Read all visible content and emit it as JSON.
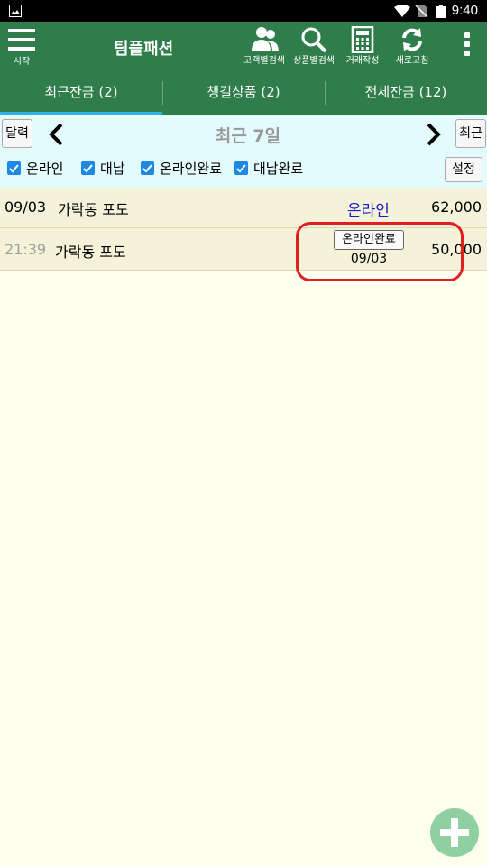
{
  "status_bar": {
    "time": "9:40"
  },
  "app_bar": {
    "menu_label": "시작",
    "title": "팀플패션",
    "tools": [
      {
        "icon": "people-icon",
        "label": "고객별검색"
      },
      {
        "icon": "search-icon",
        "label": "상품별검색"
      },
      {
        "icon": "calculator-icon",
        "label": "거래작성"
      },
      {
        "icon": "refresh-icon",
        "label": "새로고침"
      }
    ]
  },
  "tabs": [
    {
      "label": "최근잔금 (2)",
      "active": true
    },
    {
      "label": "챙길상품 (2)",
      "active": false
    },
    {
      "label": "전체잔금 (12)",
      "active": false
    }
  ],
  "filter": {
    "calendar_button": "달력",
    "period": "최근 7일",
    "recent_button": "최근",
    "settings_button": "설정",
    "checkboxes": [
      {
        "label": "온라인",
        "checked": true
      },
      {
        "label": "대납",
        "checked": true
      },
      {
        "label": "온라인완료",
        "checked": true
      },
      {
        "label": "대납완료",
        "checked": true
      }
    ]
  },
  "rows": [
    {
      "date": "09/03",
      "customer": "가락동 포도",
      "status": "온라인",
      "amount": "62,000"
    },
    {
      "time": "21:39",
      "customer": "가락동 포도",
      "status_badge": "온라인완료",
      "status_date": "09/03",
      "amount": "50,000"
    }
  ],
  "colors": {
    "app_bar": "#2e7d4a",
    "tab_indicator": "#2fb3e6",
    "filter_bg": "#e4fbfd",
    "row_bg": "#f4f2d8",
    "online_text": "#1a1acc",
    "highlight": "#e02020",
    "fab": "#8fcfa0"
  }
}
